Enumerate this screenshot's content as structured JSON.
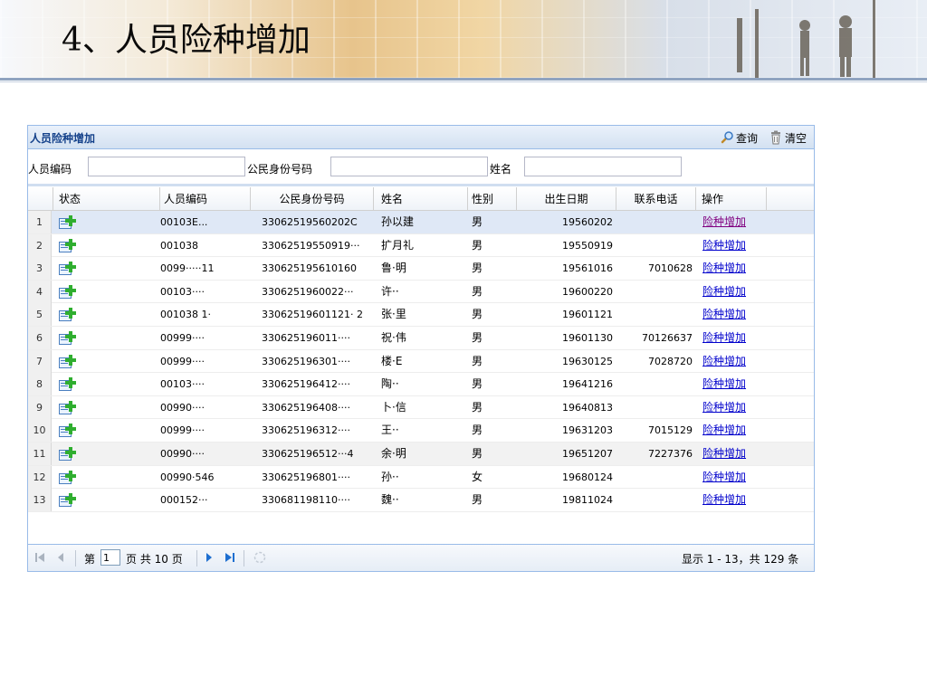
{
  "slide": {
    "title": "4、人员险种增加"
  },
  "panel": {
    "title": "人员险种增加",
    "search_label": "查询",
    "clear_label": "清空"
  },
  "form": {
    "code_label": "人员编码",
    "code_value": "",
    "id_label": "公民身份号码",
    "id_value": "",
    "name_label": "姓名",
    "name_value": ""
  },
  "grid": {
    "headers": [
      "状态",
      "人员编码",
      "公民身份号码",
      "姓名",
      "性别",
      "出生日期",
      "联系电话",
      "操作"
    ],
    "rows": [
      {
        "num": "1",
        "code": "00103E...",
        "id": "33062519560202C",
        "name": "孙以建",
        "sex": "男",
        "birth": "19560202",
        "phone": "",
        "op": "险种增加"
      },
      {
        "num": "2",
        "code": "001038",
        "id": "33062519550919···",
        "name": "扩月礼",
        "sex": "男",
        "birth": "19550919",
        "phone": "",
        "op": "险种增加"
      },
      {
        "num": "3",
        "code": "0099·····11",
        "id": "330625195610160",
        "name": "鲁·明",
        "sex": "男",
        "birth": "19561016",
        "phone": "7010628",
        "op": "险种增加"
      },
      {
        "num": "4",
        "code": "00103····",
        "id": "3306251960022···",
        "name": "许··",
        "sex": "男",
        "birth": "19600220",
        "phone": "",
        "op": "险种增加"
      },
      {
        "num": "5",
        "code": "001038 1·",
        "id": "33062519601121· 2",
        "name": "张·里",
        "sex": "男",
        "birth": "19601121",
        "phone": "",
        "op": "险种增加"
      },
      {
        "num": "6",
        "code": "00999····",
        "id": "330625196011····",
        "name": "祝·伟",
        "sex": "男",
        "birth": "19601130",
        "phone": "70126637",
        "op": "险种增加"
      },
      {
        "num": "7",
        "code": "00999····",
        "id": "330625196301····",
        "name": "楼·E",
        "sex": "男",
        "birth": "19630125",
        "phone": "7028720",
        "op": "险种增加"
      },
      {
        "num": "8",
        "code": "00103····",
        "id": "330625196412····",
        "name": "陶··",
        "sex": "男",
        "birth": "19641216",
        "phone": "",
        "op": "险种增加"
      },
      {
        "num": "9",
        "code": "00990····",
        "id": "330625196408····",
        "name": "卜·信",
        "sex": "男",
        "birth": "19640813",
        "phone": "",
        "op": "险种增加"
      },
      {
        "num": "10",
        "code": "00999····",
        "id": "330625196312····",
        "name": "王··",
        "sex": "男",
        "birth": "19631203",
        "phone": "7015129",
        "op": "险种增加"
      },
      {
        "num": "11",
        "code": "00990····",
        "id": "330625196512···4",
        "name": "余·明",
        "sex": "男",
        "birth": "19651207",
        "phone": "7227376",
        "op": "险种增加"
      },
      {
        "num": "12",
        "code": "00990·546",
        "id": "330625196801····",
        "name": "孙··",
        "sex": "女",
        "birth": "19680124",
        "phone": "",
        "op": "险种增加"
      },
      {
        "num": "13",
        "code": "000152···",
        "id": "330681198110····",
        "name": "魏··",
        "sex": "男",
        "birth": "19811024",
        "phone": "",
        "op": "险种增加"
      }
    ]
  },
  "pager": {
    "page_prefix": "第",
    "page_value": "1",
    "page_suffix": "页 共 10 页",
    "display_info": "显示 1 - 13，共 129 条"
  },
  "colors": {
    "link": "#0000cc",
    "visited": "#800080",
    "header_bg": "#d3e1f1",
    "border": "#99bbe8"
  },
  "icons": {
    "search": "magnifier-icon",
    "clear": "trash-icon",
    "status": "add-person-icon"
  }
}
